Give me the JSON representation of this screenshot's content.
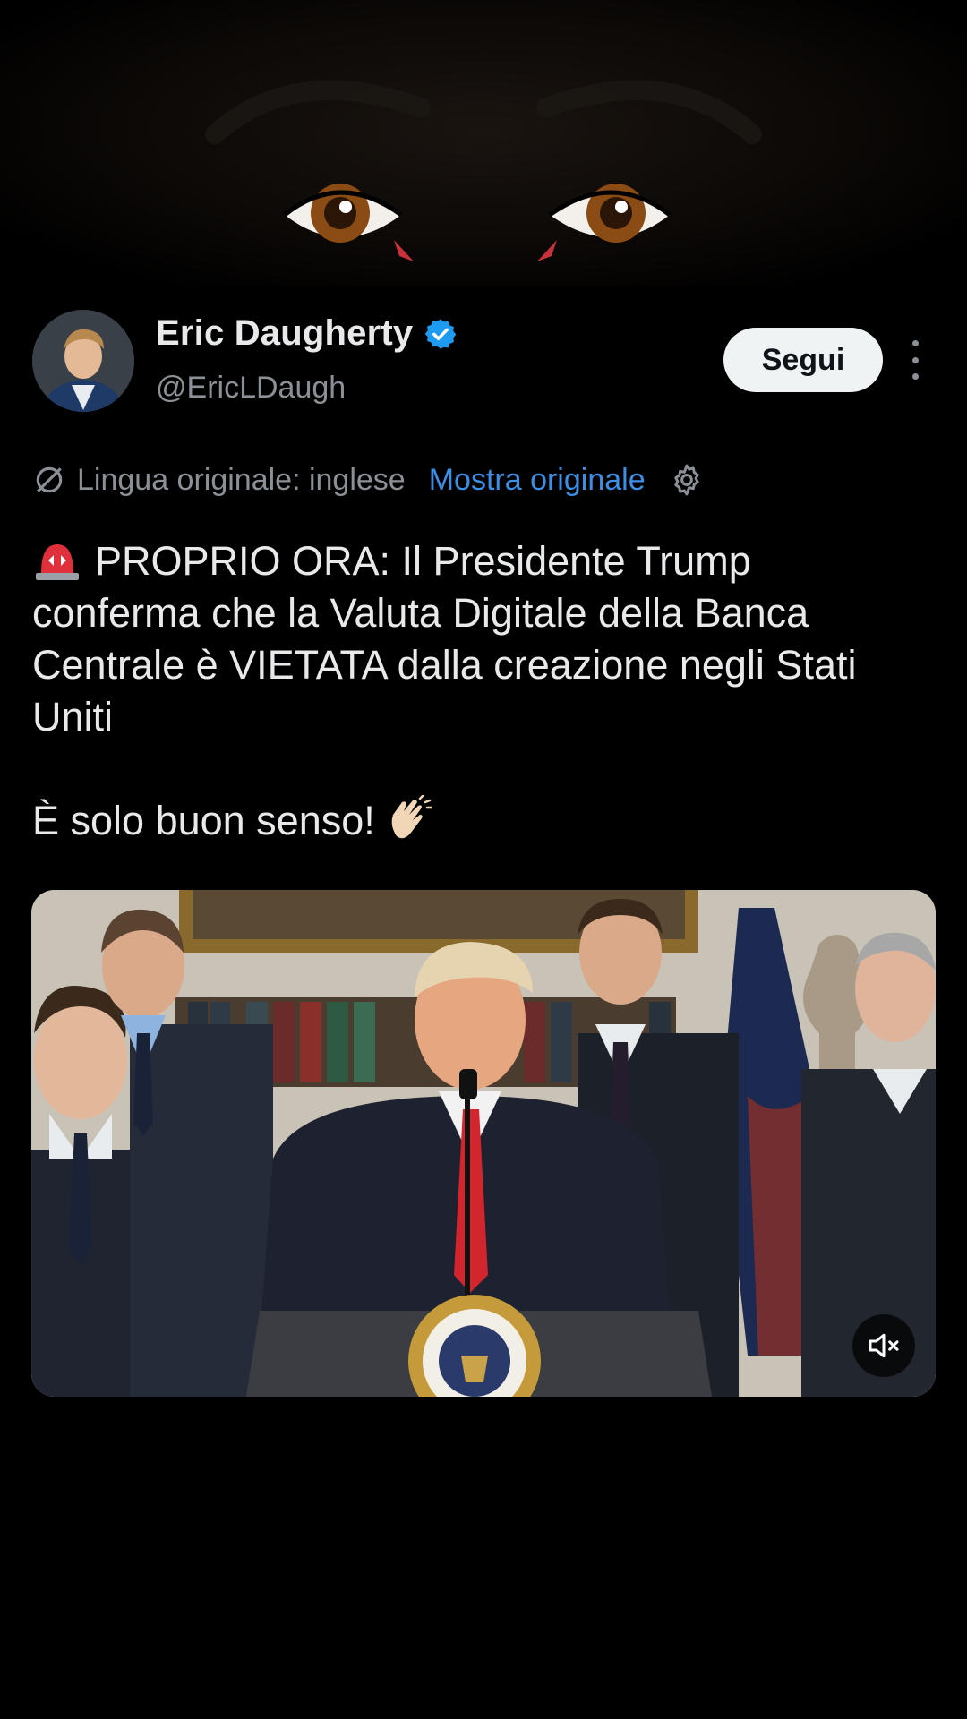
{
  "author": {
    "display_name": "Eric Daugherty",
    "handle": "@EricLDaugh",
    "verified_icon": "verified-badge-icon",
    "verified_color": "#1d9bf0"
  },
  "actions": {
    "follow_label": "Segui",
    "more_icon": "more-vertical-icon"
  },
  "translation": {
    "source_label": "Lingua originale: inglese",
    "show_original_label": "Mostra originale",
    "link_color": "#3b8fe6"
  },
  "post": {
    "lines": [
      "PROPRIO ORA: Il Presidente Trump",
      "conferma che la Valuta Digitale della Banca",
      "Centrale è VIETATA dalla creazione negli Stati",
      "Uniti"
    ],
    "closing": "È solo buon senso!",
    "leading_emoji": "siren-icon",
    "trailing_emoji": "clapping-hands-icon"
  },
  "media": {
    "type": "video",
    "muted_icon": "speaker-muted-icon"
  }
}
